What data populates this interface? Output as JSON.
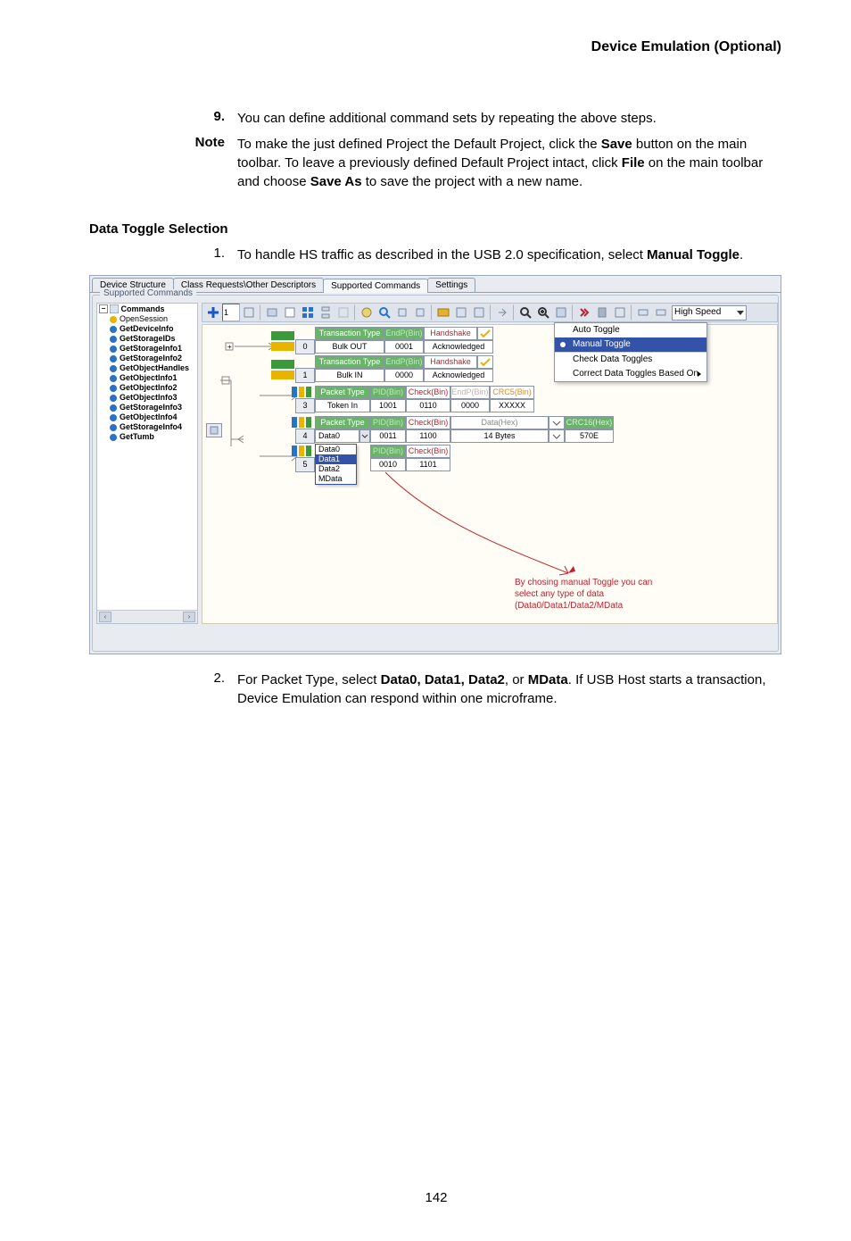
{
  "header": "Device Emulation (Optional)",
  "p9_num": "9.",
  "p9": "You can define additional command sets by repeating the above steps.",
  "note_lab": "Note",
  "note1": "To make the just defined Project the Default Project, click the ",
  "note_b1": "Save",
  "note2": " button on the main toolbar. To leave a previously defined Default Project intact, click ",
  "note_b2": "File",
  "note3": " on the main toolbar and choose ",
  "note_b3": "Save As",
  "note4": " to save the project with a new name.",
  "h2": "Data Toggle Selection",
  "s1_num": "1.",
  "s1_a": "To  handle HS traffic as described in the USB 2.0 speci",
  "s1_b": "fication, select ",
  "s1_c": "Manual Toggle",
  "s1_d": ".",
  "s2_num": "2.",
  "s2_a": "For Packet Type, select ",
  "s2_b1": "Data0, Data1, Data2",
  "s2_b": ", or ",
  "s2_b2": "MData",
  "s2_c": ". If USB Host starts a transaction, Device Emulation can respond within one microframe.",
  "footer": "142",
  "tabs": [
    "Device Structure",
    "Class Requests\\Other Descriptors",
    "Supported Commands",
    "Settings"
  ],
  "group": "Supported Commands",
  "tree": {
    "root": "Commands",
    "items": [
      "OpenSession",
      "GetDeviceInfo",
      "GetStorageIDs",
      "GetStorageInfo1",
      "GetStorageInfo2",
      "GetObjectHandles",
      "GetObjectInfo1",
      "GetObjectInfo2",
      "GetObjectInfo3",
      "GetStorageInfo3",
      "GetObjectInfo4",
      "GetStorageInfo4",
      "GetTumb"
    ]
  },
  "speed": "High Speed",
  "menu": {
    "items": [
      "Auto Toggle",
      "Manual Toggle",
      "Check Data Toggles",
      "Correct Data Toggles Based On"
    ],
    "selected": 1
  },
  "rows": {
    "r0": {
      "num": "0",
      "h": [
        "Transaction Type",
        "EndP(Bin)",
        "Handshake"
      ],
      "v": [
        "Bulk OUT",
        "0001",
        "Acknowledged"
      ]
    },
    "r1": {
      "num": "1",
      "h": [
        "Transaction Type",
        "EndP(Bin)",
        "Handshake"
      ],
      "v": [
        "Bulk IN",
        "0000",
        "Acknowledged"
      ]
    },
    "r3": {
      "num": "3",
      "h": [
        "Packet Type",
        "PID(Bin)",
        "Check(Bin)",
        "EndP(Bin)",
        "CRC5(Bin)"
      ],
      "v": [
        "Token In",
        "1001",
        "0110",
        "0000",
        "XXXXX"
      ]
    },
    "r4": {
      "num": "4",
      "h": [
        "Packet Type",
        "PID(Bin)",
        "Check(Bin)",
        "",
        "Data(Hex)",
        "",
        "CRC16(Hex)"
      ],
      "v": [
        "Data0",
        "0011",
        "1100",
        "",
        "14 Bytes",
        "",
        "570E"
      ]
    },
    "r5": {
      "num": "5",
      "h": [
        "",
        "PID(Bin)",
        "Check(Bin)"
      ],
      "v": [
        "",
        "0010",
        "1101"
      ]
    }
  },
  "data_options": [
    "Data0",
    "Data1",
    "Data2",
    "MData"
  ],
  "annotation": "By chosing manual Toggle you can select any type of data (Data0/Data1/Data2/MData"
}
